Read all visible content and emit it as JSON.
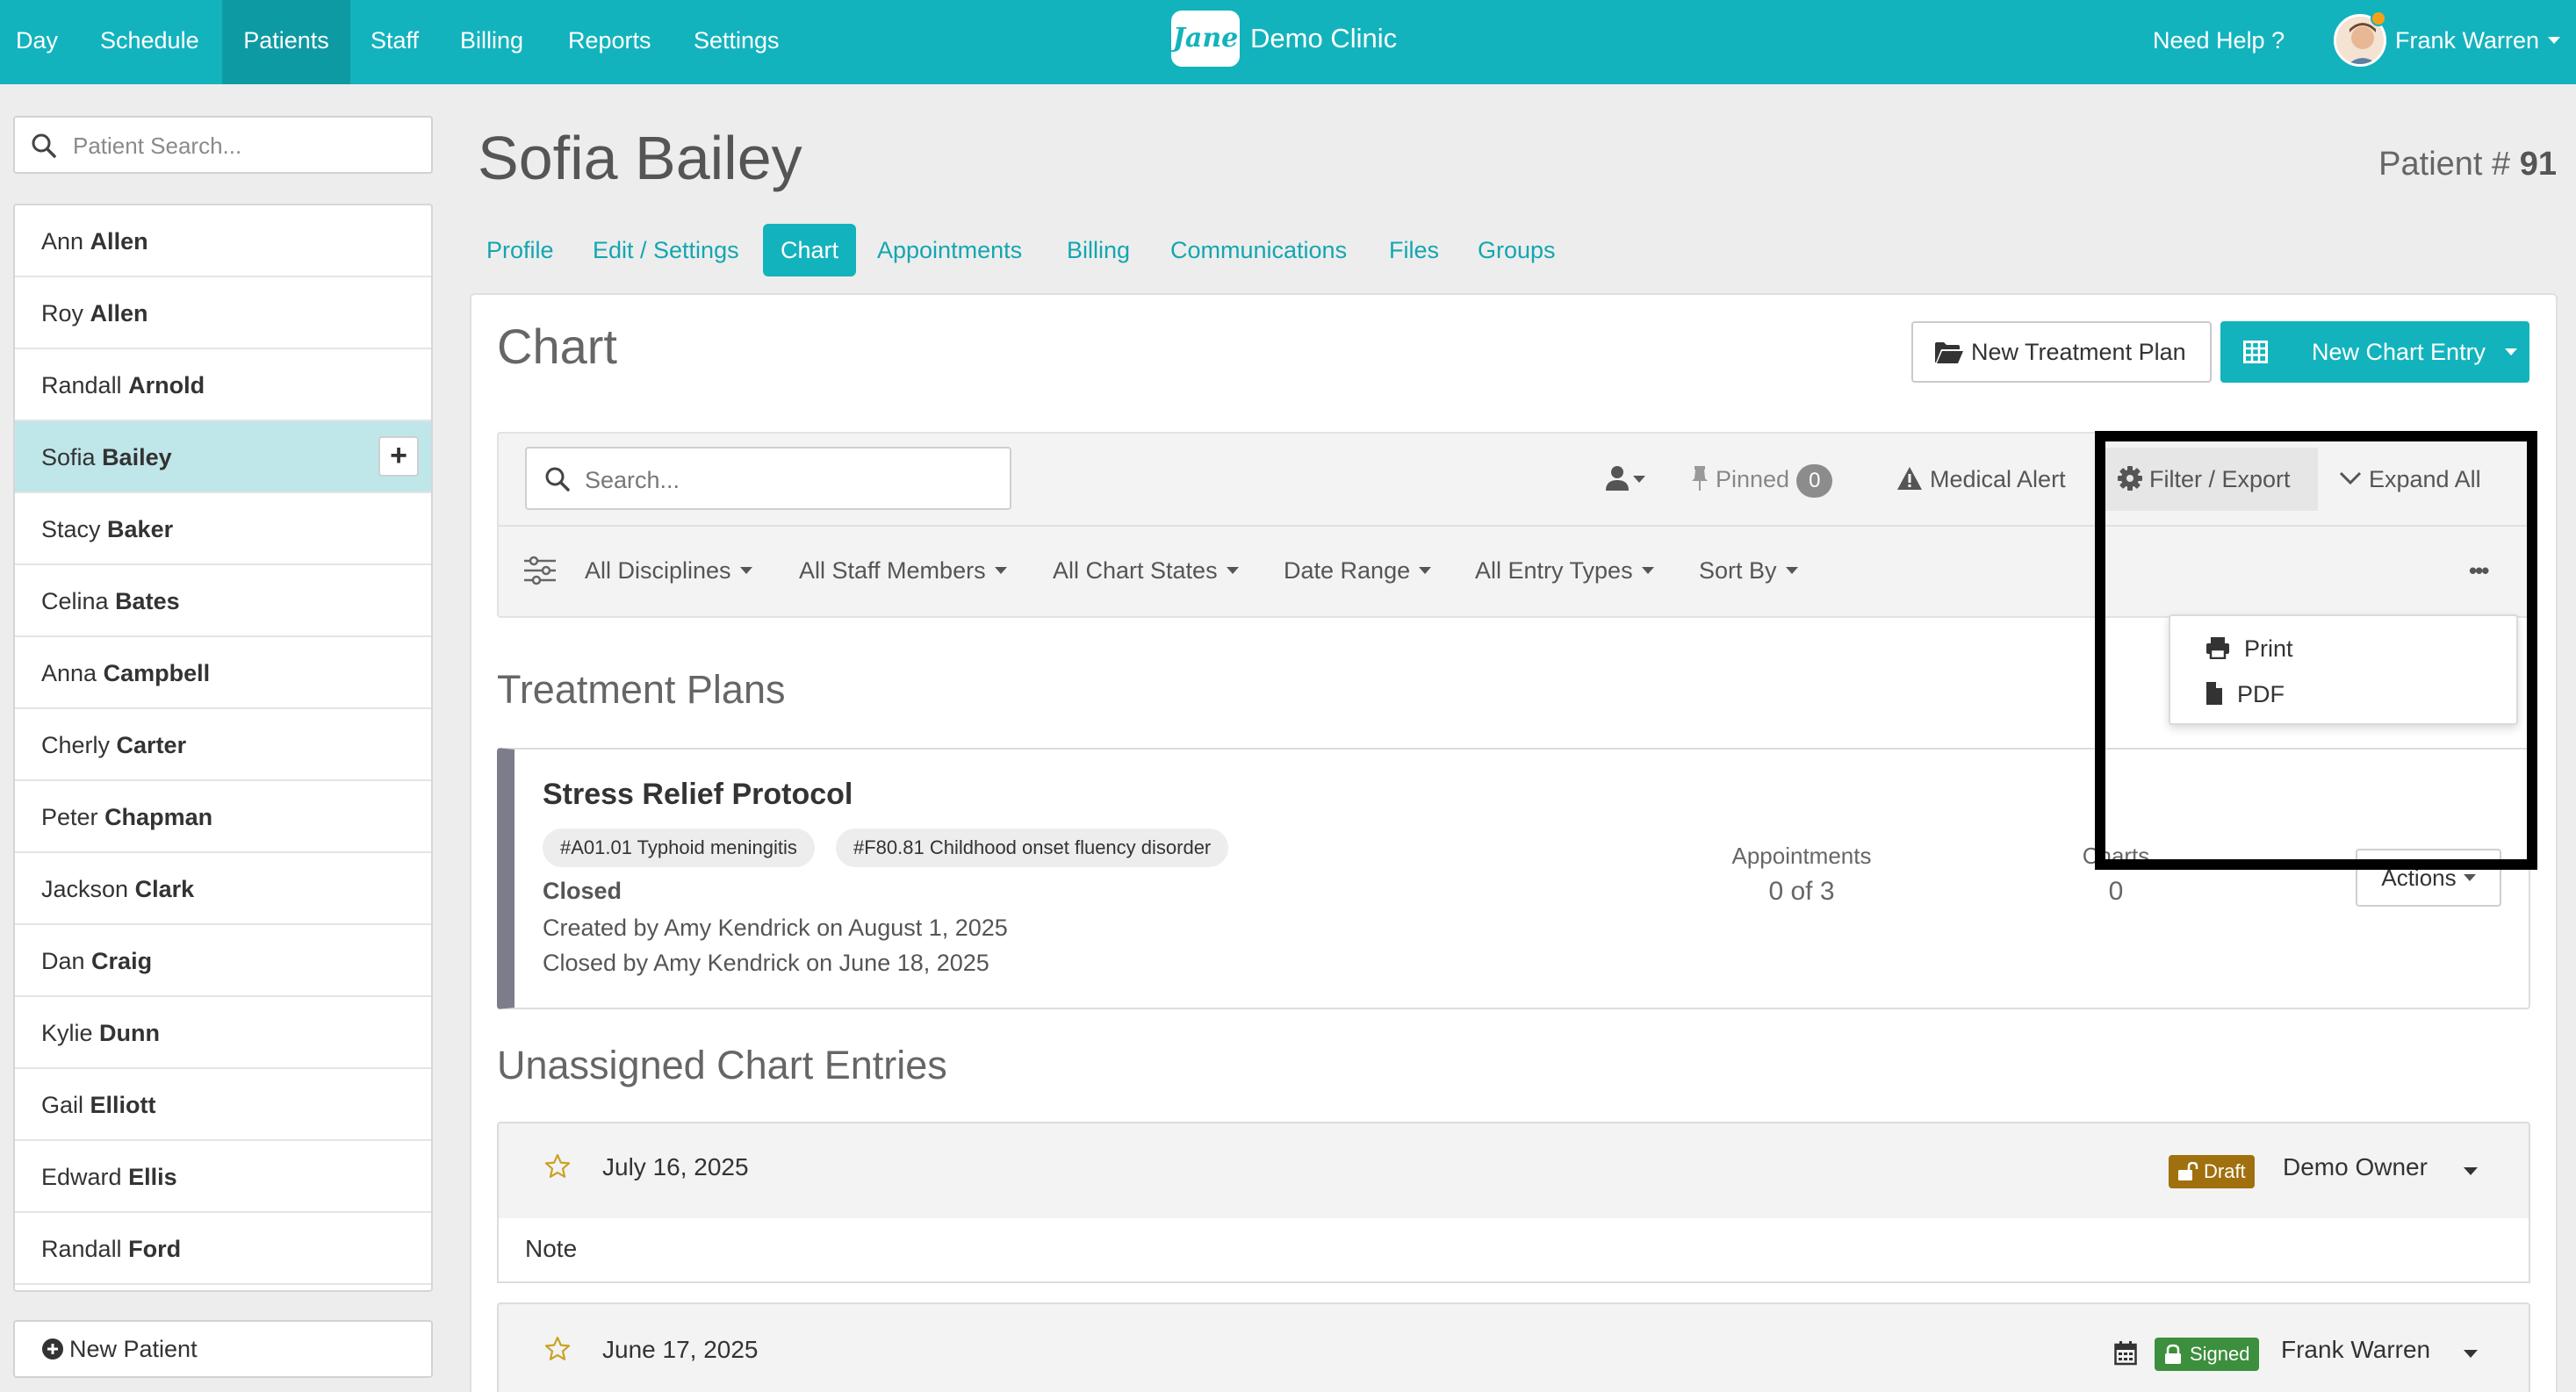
{
  "nav": {
    "items": [
      "Day",
      "Schedule",
      "Patients",
      "Staff",
      "Billing",
      "Reports",
      "Settings"
    ],
    "active": "Patients",
    "logo_text": "Jane",
    "clinic_name": "Demo Clinic",
    "help": "Need Help ?",
    "user_name": "Frank Warren"
  },
  "sidebar": {
    "search_placeholder": "Patient Search...",
    "patients": [
      {
        "first": "Ann",
        "last": "Allen"
      },
      {
        "first": "Roy",
        "last": "Allen"
      },
      {
        "first": "Randall",
        "last": "Arnold"
      },
      {
        "first": "Sofia",
        "last": "Bailey",
        "selected": true
      },
      {
        "first": "Stacy",
        "last": "Baker"
      },
      {
        "first": "Celina",
        "last": "Bates"
      },
      {
        "first": "Anna",
        "last": "Campbell"
      },
      {
        "first": "Cherly",
        "last": "Carter"
      },
      {
        "first": "Peter",
        "last": "Chapman"
      },
      {
        "first": "Jackson",
        "last": "Clark"
      },
      {
        "first": "Dan",
        "last": "Craig"
      },
      {
        "first": "Kylie",
        "last": "Dunn"
      },
      {
        "first": "Gail",
        "last": "Elliott"
      },
      {
        "first": "Edward",
        "last": "Ellis"
      },
      {
        "first": "Randall",
        "last": "Ford"
      }
    ],
    "add_symbol": "+",
    "new_patient": "New Patient"
  },
  "patient": {
    "name": "Sofia Bailey",
    "number_label": "Patient #",
    "number": "91"
  },
  "tabs": [
    "Profile",
    "Edit / Settings",
    "Chart",
    "Appointments",
    "Billing",
    "Communications",
    "Files",
    "Groups"
  ],
  "active_tab": "Chart",
  "chart": {
    "heading": "Chart",
    "new_treatment_plan": "New Treatment Plan",
    "new_chart_entry": "New Chart Entry",
    "search_placeholder": "Search...",
    "pinned_label": "Pinned",
    "pinned_count": "0",
    "medical_alert": "Medical Alert",
    "filter_export": "Filter / Export",
    "expand_all": "Expand All",
    "filters": [
      "All Disciplines",
      "All Staff Members",
      "All Chart States",
      "Date Range",
      "All Entry Types",
      "Sort By"
    ],
    "more": "•••",
    "export_menu": {
      "print": "Print",
      "pdf": "PDF"
    }
  },
  "treatment_plans": {
    "heading": "Treatment Plans",
    "plan": {
      "title": "Stress Relief Protocol",
      "tags": [
        "#A01.01 Typhoid meningitis",
        "#F80.81 Childhood onset fluency disorder"
      ],
      "status": "Closed",
      "created": "Created by Amy Kendrick on August 1, 2025",
      "closed": "Closed by Amy Kendrick on June 18, 2025",
      "appointments_label": "Appointments",
      "appointments_value": "0 of 3",
      "charts_label": "Charts",
      "charts_value": "0",
      "actions": "Actions"
    }
  },
  "unassigned": {
    "heading": "Unassigned Chart Entries",
    "entries": [
      {
        "date": "July 16, 2025",
        "state": "Draft",
        "state_color": "#a0700f",
        "author": "Demo Owner",
        "note": "Note"
      },
      {
        "date": "June 17, 2025",
        "state": "Signed",
        "state_color": "#3c8f3c",
        "author": "Frank Warren"
      }
    ]
  },
  "colors": {
    "brand": "#13b3bd",
    "brand_dark": "#0e9aa3",
    "selected_row": "#bfe6e8",
    "plan_stripe": "#7c7c8a"
  }
}
